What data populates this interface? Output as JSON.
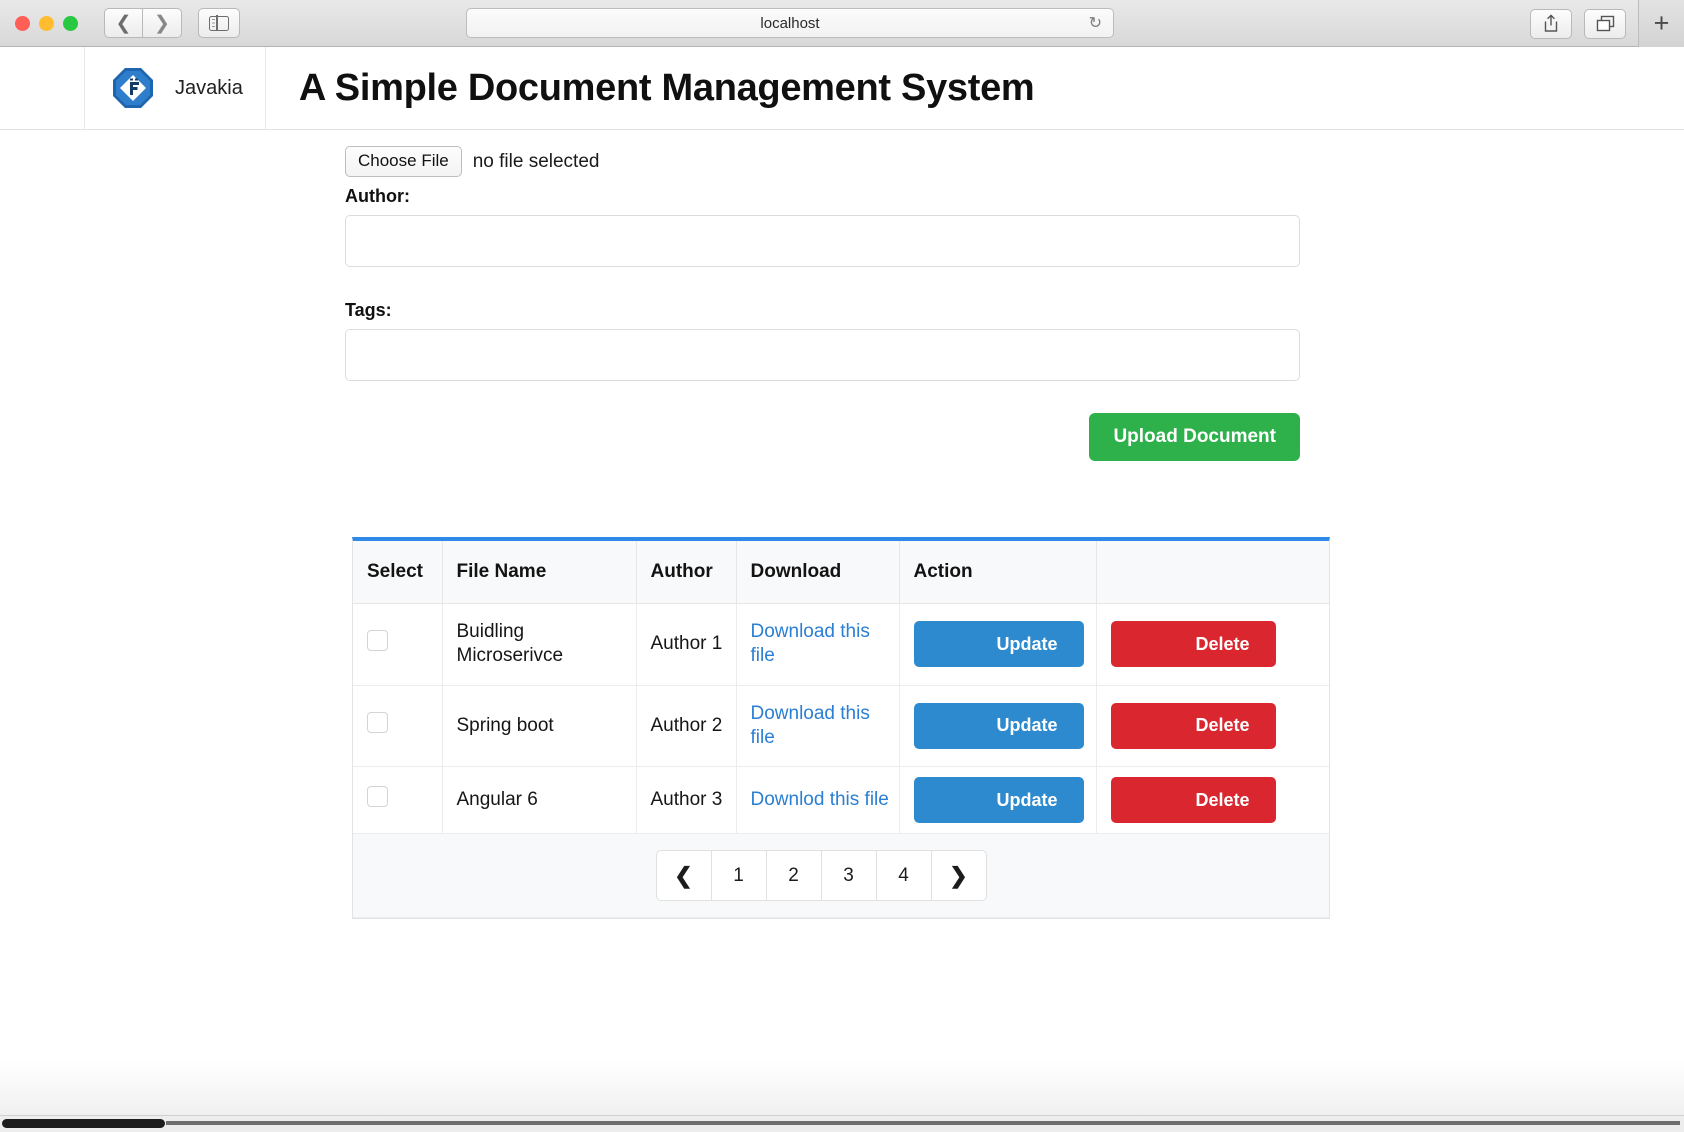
{
  "browser": {
    "url_text": "localhost",
    "back_icon": "chevron-left-icon",
    "forward_icon": "chevron-right-icon",
    "sidebar_icon": "sidebar-toggle-icon",
    "reload_glyph": "↻",
    "share_icon": "share-icon",
    "tabs_icon": "tab-overview-icon",
    "new_tab_glyph": "+"
  },
  "navbar": {
    "brand_name": "Javakia",
    "brand_logo_icon": "javakia-logo-icon",
    "page_title": "A Simple Document Management System"
  },
  "form": {
    "choose_file_label": "Choose File",
    "file_status": "no file selected",
    "author_label": "Author:",
    "author_value": "",
    "author_placeholder": "",
    "tags_label": "Tags:",
    "tags_value": "",
    "tags_placeholder": "",
    "upload_button": "Upload Document",
    "upload_button_color": "#2eb04a"
  },
  "table": {
    "accent_color": "#2e8ae6",
    "headers": [
      "Select",
      "File Name",
      "Author",
      "Download",
      "Action",
      ""
    ],
    "rows": [
      {
        "selected": false,
        "file_name": "Buidling Microserivce",
        "author": "Author 1",
        "download_link": "Download this file",
        "update_label": "Update",
        "delete_label": "Delete"
      },
      {
        "selected": false,
        "file_name": "Spring boot",
        "author": "Author 2",
        "download_link": "Download this file",
        "update_label": "Update",
        "delete_label": "Delete"
      },
      {
        "selected": false,
        "file_name": "Angular 6",
        "author": "Author 3",
        "download_link": "Downlod this file",
        "update_label": "Update",
        "delete_label": "Delete"
      }
    ],
    "update_color": "#2e8ace",
    "delete_color": "#d9262f",
    "link_color": "#2a7fd4"
  },
  "pagination": {
    "prev_glyph": "❮",
    "next_glyph": "❯",
    "pages": [
      "1",
      "2",
      "3",
      "4"
    ],
    "current_page": "1"
  }
}
